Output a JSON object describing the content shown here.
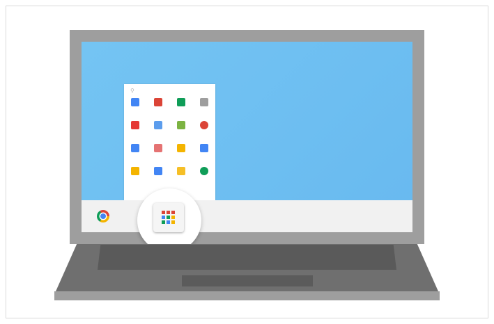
{
  "illustration": {
    "colors": {
      "screen": "#74c4f3",
      "laptop_body": "#9e9e9e",
      "laptop_base": "#6f6f6f",
      "keyboard": "#5a5a5a",
      "shelf": "#f1f1f1"
    },
    "launcher": {
      "search_icon": "search-icon",
      "apps": [
        {
          "icon": "docs-app-icon",
          "color": "#4285f4"
        },
        {
          "icon": "gmail-app-icon",
          "color": "#db4437"
        },
        {
          "icon": "drive-app-icon",
          "color": "#0f9d58"
        },
        {
          "icon": "slides-app-icon",
          "color": "#9e9e9e"
        },
        {
          "icon": "youtube-app-icon",
          "color": "#e53935"
        },
        {
          "icon": "files-app-icon",
          "color": "#5c9ded"
        },
        {
          "icon": "photos-app-icon",
          "color": "#7cb342"
        },
        {
          "icon": "chrome-app-icon",
          "color": "#db4437"
        },
        {
          "icon": "maps-app-icon",
          "color": "#4285f4"
        },
        {
          "icon": "calendar-app-icon",
          "color": "#e57373"
        },
        {
          "icon": "play-music-app-icon",
          "color": "#f4b400"
        },
        {
          "icon": "sheets-app-icon",
          "color": "#4285f4"
        },
        {
          "icon": "keep-app-icon",
          "color": "#f4b400"
        },
        {
          "icon": "store-app-icon",
          "color": "#4285f4"
        },
        {
          "icon": "mail-app-icon",
          "color": "#f6bf26"
        },
        {
          "icon": "hangouts-app-icon",
          "color": "#0f9d58"
        }
      ]
    },
    "shelf": {
      "browser_icon": "chrome-icon",
      "launcher_button_icon": "app-launcher-icon",
      "launcher_dots": [
        "#db4437",
        "#db4437",
        "#db4437",
        "#4285f4",
        "#0f9d58",
        "#f4b400",
        "#0f9d58",
        "#4285f4",
        "#f4b400"
      ]
    }
  }
}
